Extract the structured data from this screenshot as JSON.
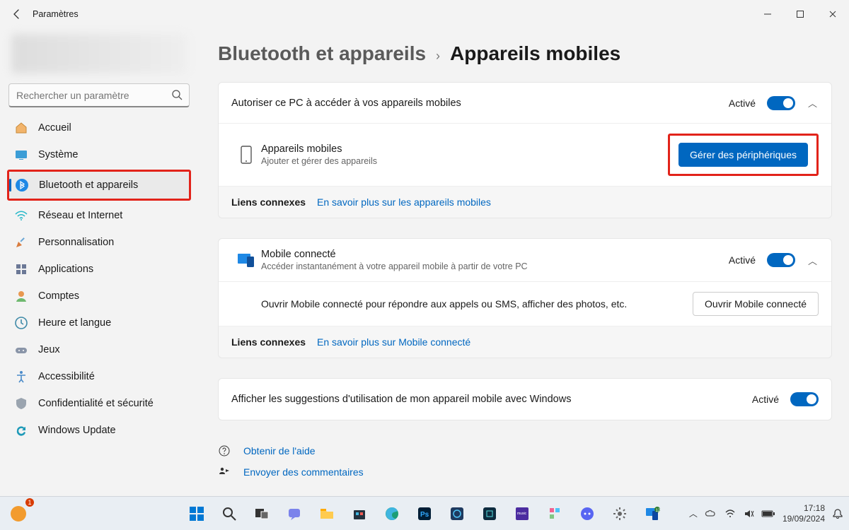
{
  "titlebar": {
    "title": "Paramètres"
  },
  "search": {
    "placeholder": "Rechercher un paramètre"
  },
  "sidebar": {
    "items": [
      {
        "label": "Accueil"
      },
      {
        "label": "Système"
      },
      {
        "label": "Bluetooth et appareils"
      },
      {
        "label": "Réseau et Internet"
      },
      {
        "label": "Personnalisation"
      },
      {
        "label": "Applications"
      },
      {
        "label": "Comptes"
      },
      {
        "label": "Heure et langue"
      },
      {
        "label": "Jeux"
      },
      {
        "label": "Accessibilité"
      },
      {
        "label": "Confidentialité et sécurité"
      },
      {
        "label": "Windows Update"
      }
    ]
  },
  "breadcrumb": {
    "parent": "Bluetooth et appareils",
    "current": "Appareils mobiles"
  },
  "section1": {
    "header": "Autoriser ce PC à accéder à vos appareils mobiles",
    "state": "Activé",
    "row_title": "Appareils mobiles",
    "row_sub": "Ajouter et gérer des appareils",
    "button": "Gérer des périphériques",
    "links_label": "Liens connexes",
    "link": "En savoir plus sur les appareils mobiles"
  },
  "section2": {
    "title": "Mobile connecté",
    "sub": "Accéder instantanément à votre appareil mobile à partir de votre PC",
    "state": "Activé",
    "row_text": "Ouvrir Mobile connecté pour répondre aux appels ou SMS, afficher des photos, etc.",
    "button": "Ouvrir Mobile connecté",
    "links_label": "Liens connexes",
    "link": "En savoir plus sur Mobile connecté"
  },
  "section3": {
    "text": "Afficher les suggestions d'utilisation de mon appareil mobile avec Windows",
    "state": "Activé"
  },
  "footer": {
    "help": "Obtenir de l'aide",
    "feedback": "Envoyer des commentaires"
  },
  "tray": {
    "time": "17:18",
    "date": "19/09/2024"
  }
}
